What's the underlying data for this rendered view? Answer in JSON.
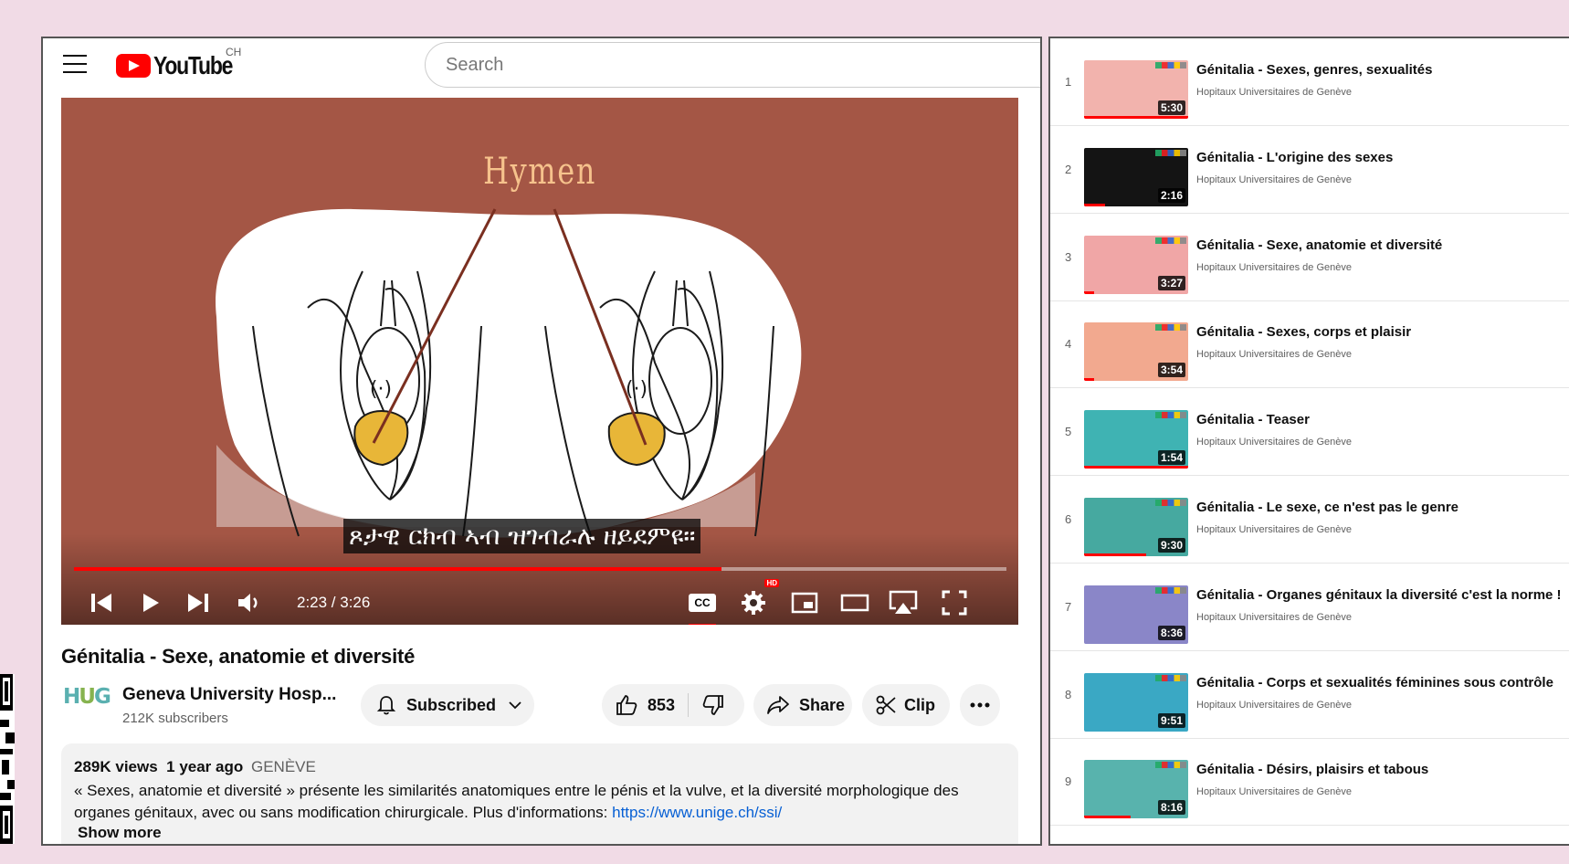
{
  "header": {
    "logo_text": "YouTube",
    "region": "CH",
    "search_placeholder": "Search"
  },
  "player": {
    "overlay_label": "Hymen",
    "subtitle": "ጾታዊ ርክብ ኣብ ዝገብራሉ ዘይደምዩ።",
    "time": "2:23 / 3:26",
    "progress_fraction": 0.694,
    "cc_label": "CC",
    "hd_badge": "HD"
  },
  "video": {
    "title": "Génitalia - Sexe, anatomie et diversité",
    "channel_logo": "HUG",
    "channel_name": "Geneva University Hosp...",
    "subscribers": "212K subscribers",
    "subscribe_label": "Subscribed",
    "likes": "853",
    "share_label": "Share",
    "clip_label": "Clip"
  },
  "description": {
    "views": "289K views",
    "age": "1 year ago",
    "location": "GENÈVE",
    "text": "« Sexes, anatomie et diversité » présente les similarités anatomiques entre le pénis et la vulve, et la diversité morphologique des organes génitaux, avec ou sans modification chirurgicale. Plus d'informations: ",
    "link": "https://www.unige.ch/ssi/",
    "show_more": "Show more"
  },
  "playlist": {
    "items": [
      {
        "num": "1",
        "title": "Génitalia - Sexes, genres, sexualités",
        "channel": "Hopitaux Universitaires de Genève",
        "duration": "5:30",
        "watched": 1.0,
        "thumb": "#f2b3ad"
      },
      {
        "num": "2",
        "title": "Génitalia - L'origine des sexes",
        "channel": "Hopitaux Universitaires de Genève",
        "duration": "2:16",
        "watched": 0.2,
        "thumb": "#141414"
      },
      {
        "num": "3",
        "title": "Génitalia - Sexe, anatomie et diversité",
        "channel": "Hopitaux Universitaires de Genève",
        "duration": "3:27",
        "watched": 0.1,
        "thumb": "#f0a6a6"
      },
      {
        "num": "4",
        "title": "Génitalia - Sexes, corps et plaisir",
        "channel": "Hopitaux Universitaires de Genève",
        "duration": "3:54",
        "watched": 0.1,
        "thumb": "#f2a98f"
      },
      {
        "num": "5",
        "title": "Génitalia - Teaser",
        "channel": "Hopitaux Universitaires de Genève",
        "duration": "1:54",
        "watched": 1.0,
        "thumb": "#3fb3b3"
      },
      {
        "num": "6",
        "title": "Génitalia - Le sexe, ce n'est pas le genre",
        "channel": "Hopitaux Universitaires de Genève",
        "duration": "9:30",
        "watched": 0.6,
        "thumb": "#46a9a0"
      },
      {
        "num": "7",
        "title": "Génitalia - Organes génitaux la diversité c'est la norme !",
        "channel": "Hopitaux Universitaires de Genève",
        "duration": "8:36",
        "watched": 0.0,
        "thumb": "#8a86c8"
      },
      {
        "num": "8",
        "title": "Génitalia - Corps et sexualités féminines sous contrôle",
        "channel": "Hopitaux Universitaires de Genève",
        "duration": "9:51",
        "watched": 0.0,
        "thumb": "#3aa8c4"
      },
      {
        "num": "9",
        "title": "Génitalia - Désirs, plaisirs et tabous",
        "channel": "Hopitaux Universitaires de Genève",
        "duration": "8:16",
        "watched": 0.45,
        "thumb": "#58b3ad"
      }
    ]
  },
  "colors": {
    "accent": "#ff0000",
    "link": "#065fd4",
    "player_bg": "#a45645",
    "page_bg": "#f1dbe6"
  }
}
